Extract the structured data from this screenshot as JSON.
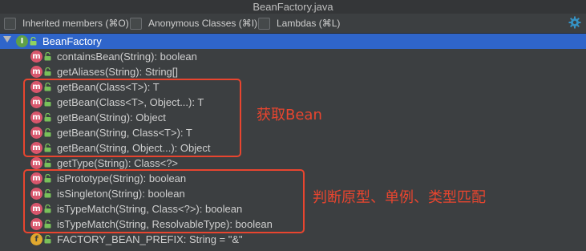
{
  "window": {
    "title": "BeanFactory.java"
  },
  "toolbar": {
    "inherited": "Inherited members (⌘O)",
    "anonymous": "Anonymous Classes (⌘I)",
    "lambdas": "Lambdas (⌘L)"
  },
  "tree": {
    "root": {
      "label": "BeanFactory",
      "icon": "interface-icon"
    },
    "members": [
      {
        "label": "containsBean(String): boolean",
        "icon": "method-icon"
      },
      {
        "label": "getAliases(String): String[]",
        "icon": "method-icon"
      },
      {
        "label": "getBean(Class<T>): T",
        "icon": "method-icon"
      },
      {
        "label": "getBean(Class<T>, Object...): T",
        "icon": "method-icon"
      },
      {
        "label": "getBean(String): Object",
        "icon": "method-icon"
      },
      {
        "label": "getBean(String, Class<T>): T",
        "icon": "method-icon"
      },
      {
        "label": "getBean(String, Object...): Object",
        "icon": "method-icon"
      },
      {
        "label": "getType(String): Class<?>",
        "icon": "method-icon"
      },
      {
        "label": "isPrototype(String): boolean",
        "icon": "method-icon"
      },
      {
        "label": "isSingleton(String): boolean",
        "icon": "method-icon"
      },
      {
        "label": "isTypeMatch(String, Class<?>): boolean",
        "icon": "method-icon"
      },
      {
        "label": "isTypeMatch(String, ResolvableType): boolean",
        "icon": "method-icon"
      },
      {
        "label": "FACTORY_BEAN_PREFIX: String = \"&\"",
        "icon": "field-icon"
      }
    ]
  },
  "annotations": {
    "get_bean": "获取Bean",
    "type_checks": "判断原型、单例、类型匹配"
  },
  "colors": {
    "selection": "#2f65ca",
    "annotation": "#e8452f",
    "method_icon": "#d8566c",
    "field_icon": "#e0a82e",
    "interface_icon": "#5fa047"
  }
}
